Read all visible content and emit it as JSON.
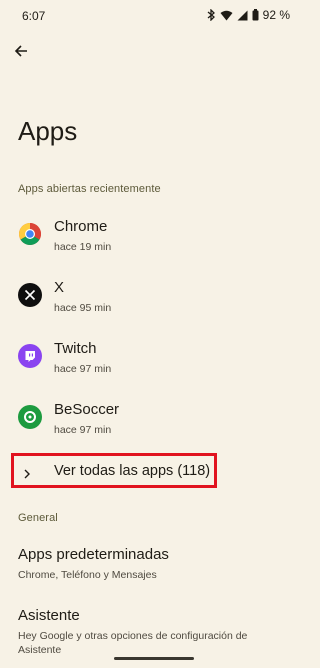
{
  "status_bar": {
    "time": "6:07",
    "battery_text": "92 %",
    "icons": [
      "bluetooth-icon",
      "wifi-icon",
      "signal-icon",
      "battery-icon"
    ]
  },
  "header": {
    "back_icon": "arrow-back-icon",
    "title": "Apps"
  },
  "recent_section": {
    "title": "Apps abiertas recientemente",
    "apps": [
      {
        "name": "Chrome",
        "subtitle": "hace 19 min",
        "icon": "chrome-icon"
      },
      {
        "name": "X",
        "subtitle": "hace 95 min",
        "icon": "x-icon"
      },
      {
        "name": "Twitch",
        "subtitle": "hace 97 min",
        "icon": "twitch-icon"
      },
      {
        "name": "BeSoccer",
        "subtitle": "hace 97 min",
        "icon": "besoccer-icon"
      }
    ],
    "see_all_label": "Ver todas las apps (118)",
    "highlight_color": "#e1131f"
  },
  "general_section": {
    "title": "General",
    "items": [
      {
        "title": "Apps predeterminadas",
        "subtitle": "Chrome, Teléfono y Mensajes"
      },
      {
        "title": "Asistente",
        "subtitle": "Hey Google y otras opciones de configuración de Asistente"
      }
    ]
  },
  "colors": {
    "background": "#f7f2e6",
    "section_header": "#5d5a3a"
  }
}
